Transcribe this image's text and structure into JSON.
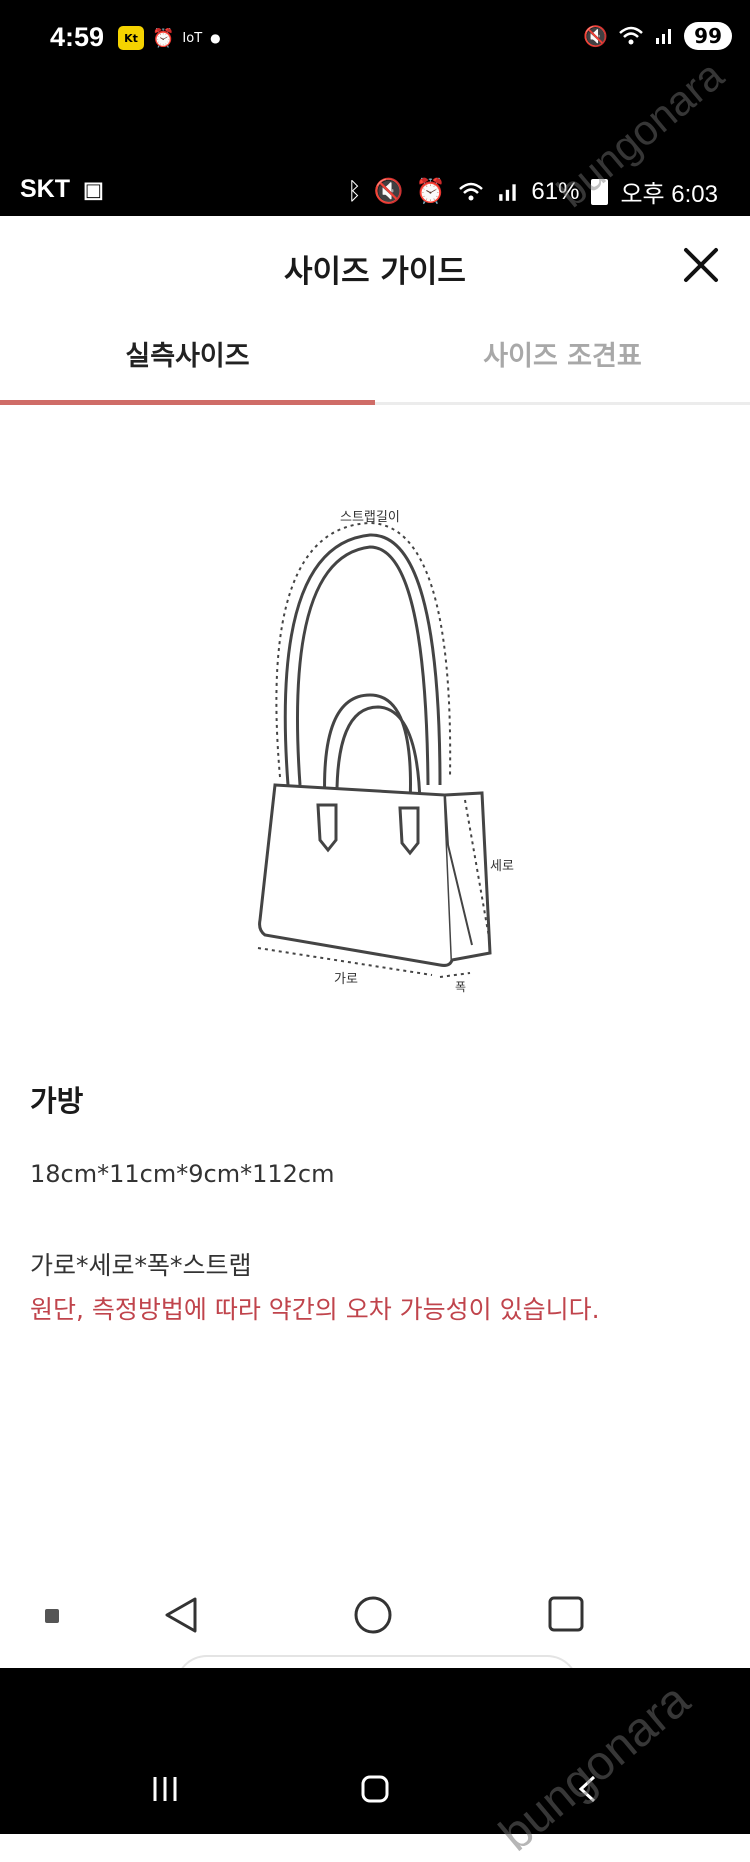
{
  "outer_status": {
    "time": "4:59",
    "app_badge": "Kt",
    "iot_label": "IoT",
    "battery": "99"
  },
  "inner_status": {
    "carrier": "SKT",
    "battery_percent": "61%",
    "time": "오후 6:03"
  },
  "header": {
    "title": "사이즈 가이드"
  },
  "tabs": [
    {
      "label": "실측사이즈",
      "active": true
    },
    {
      "label": "사이즈 조견표",
      "active": false
    }
  ],
  "diagram": {
    "strap_label": "스트랩길이",
    "height_label": "세로",
    "width_label": "가로",
    "depth_label": "폭"
  },
  "product": {
    "name": "가방",
    "dimensions": "18cm*11cm*9cm*112cm",
    "dimension_order": "가로*세로*폭*스트랩",
    "notice": "원단, 측정방법에 따라 약간의 오차 가능성이 있습니다."
  },
  "watermark": "bungonara",
  "colors": {
    "accent": "#cf6c67",
    "notice": "#c0444c"
  }
}
